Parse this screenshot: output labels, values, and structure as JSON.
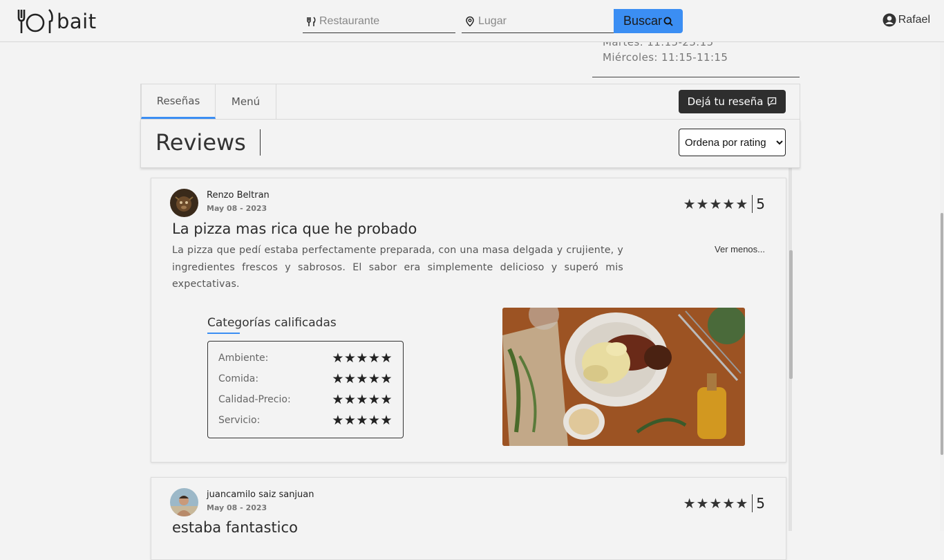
{
  "header": {
    "brand": "bait",
    "restaurant_placeholder": "Restaurante",
    "place_placeholder": "Lugar",
    "search_label": "Buscar",
    "user_name": "Rafael"
  },
  "hours": {
    "line1": "Martes: 11:15-23:15",
    "line2": "Miércoles: 11:15-11:15"
  },
  "tabs": {
    "resenas": "Reseñas",
    "menu": "Menú",
    "leave_review": "Dejá tu reseña"
  },
  "reviews_section": {
    "title": "Reviews",
    "sort_selected": "Ordena por rating"
  },
  "reviews": [
    {
      "author": "Renzo Beltran",
      "date": "May 08 - 2023",
      "stars": "★★★★★",
      "score": "5",
      "title": "La pizza mas rica que he probado",
      "body": "La pizza que pedí estaba perfectamente preparada, con una masa delgada y crujiente, y ingredientes frescos y sabrosos. El sabor era simplemente delicioso y superó mis expectativas.",
      "toggle": "Ver menos...",
      "categories_title": "Categorías calificadas",
      "categories": [
        {
          "name": "Ambiente:",
          "stars": "★★★★★"
        },
        {
          "name": "Comida:",
          "stars": "★★★★★"
        },
        {
          "name": "Calidad-Precio:",
          "stars": "★★★★★"
        },
        {
          "name": "Servicio:",
          "stars": "★★★★★"
        }
      ]
    },
    {
      "author": "juancamilo saiz sanjuan",
      "date": "May 08 - 2023",
      "stars": "★★★★★",
      "score": "5",
      "title": "estaba fantastico"
    }
  ],
  "icons": {
    "logo": "fork-plate-knife-icon",
    "restaurant_field": "fork-knife-icon",
    "place_field": "location-pin-icon",
    "search": "search-icon",
    "user": "user-circle-icon",
    "leave_review": "comment-edit-icon",
    "sort": "chevron-down-icon"
  },
  "colors": {
    "accent": "#3b8ef3",
    "dark_button": "#2e2e2e",
    "background": "#f3f3f3"
  }
}
